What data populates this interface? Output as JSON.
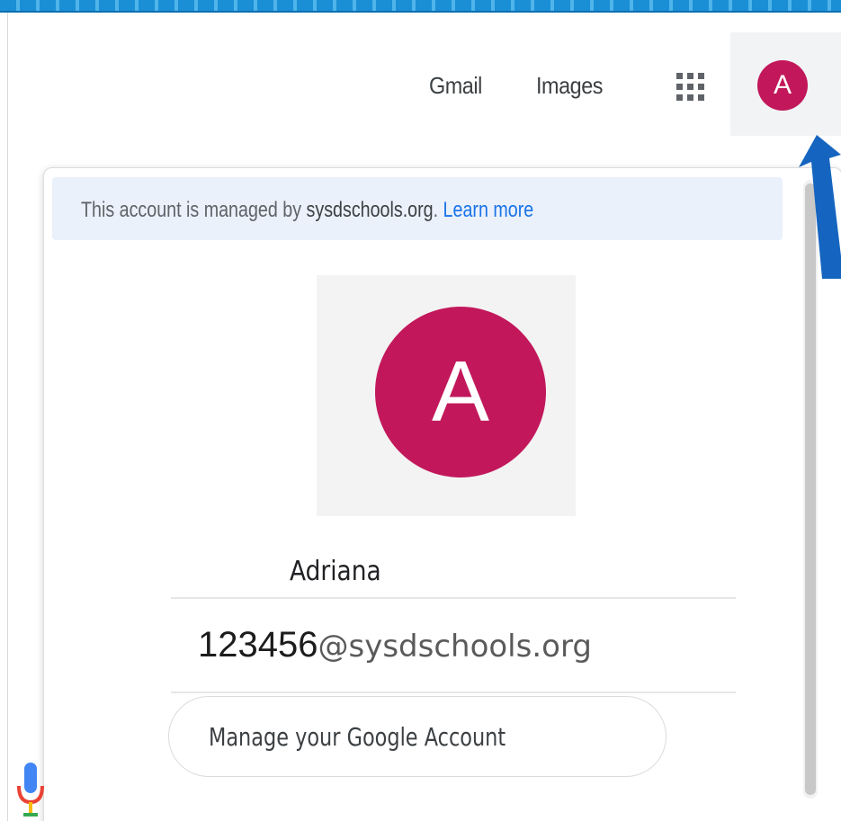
{
  "header": {
    "gmail_label": "Gmail",
    "images_label": "Images",
    "apps_icon": "apps-grid-icon",
    "avatar_initial": "A"
  },
  "account_panel": {
    "managed_notice": {
      "prefix": "This account is managed by ",
      "domain": "sysdschools.org",
      "suffix": ". ",
      "link_label": "Learn more"
    },
    "avatar_initial": "A",
    "user_name": "Adriana",
    "email_id": "123456",
    "email_domain": "@sysdschools.org",
    "manage_button_label": "Manage your Google Account"
  },
  "search_box": {
    "mic_icon": "microphone-icon"
  },
  "colors": {
    "avatar": "#c2185b",
    "link": "#1a73e8",
    "banner": "#eaf1fb",
    "annotation_arrow": "#1565c0"
  }
}
